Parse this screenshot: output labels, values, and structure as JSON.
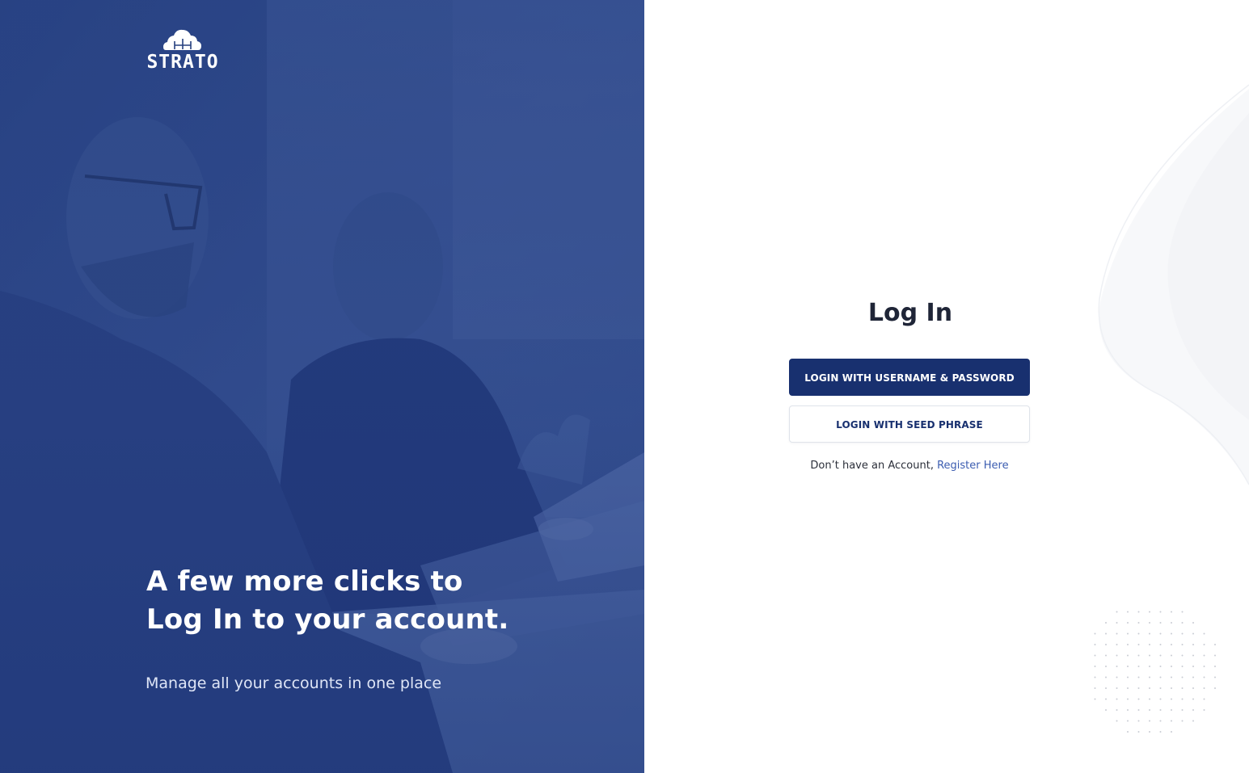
{
  "hero": {
    "logo_text": "STRATO",
    "headline_line1": "A few more clicks to",
    "headline_line2": "Log In to your account.",
    "subtitle": "Manage all your accounts in one place"
  },
  "login": {
    "title": "Log In",
    "primary_button": "LOGIN WITH USERNAME & PASSWORD",
    "secondary_button": "LOGIN WITH SEED PHRASE",
    "register_prompt": "Don’t have an Account, ",
    "register_link": "Register Here"
  },
  "colors": {
    "hero_blue": "#253f7e",
    "primary_navy": "#18306f",
    "link_blue": "#3b5cb0",
    "title_dark": "#1f2537"
  },
  "icons": {
    "logo": "cloud-building-logo-icon"
  }
}
